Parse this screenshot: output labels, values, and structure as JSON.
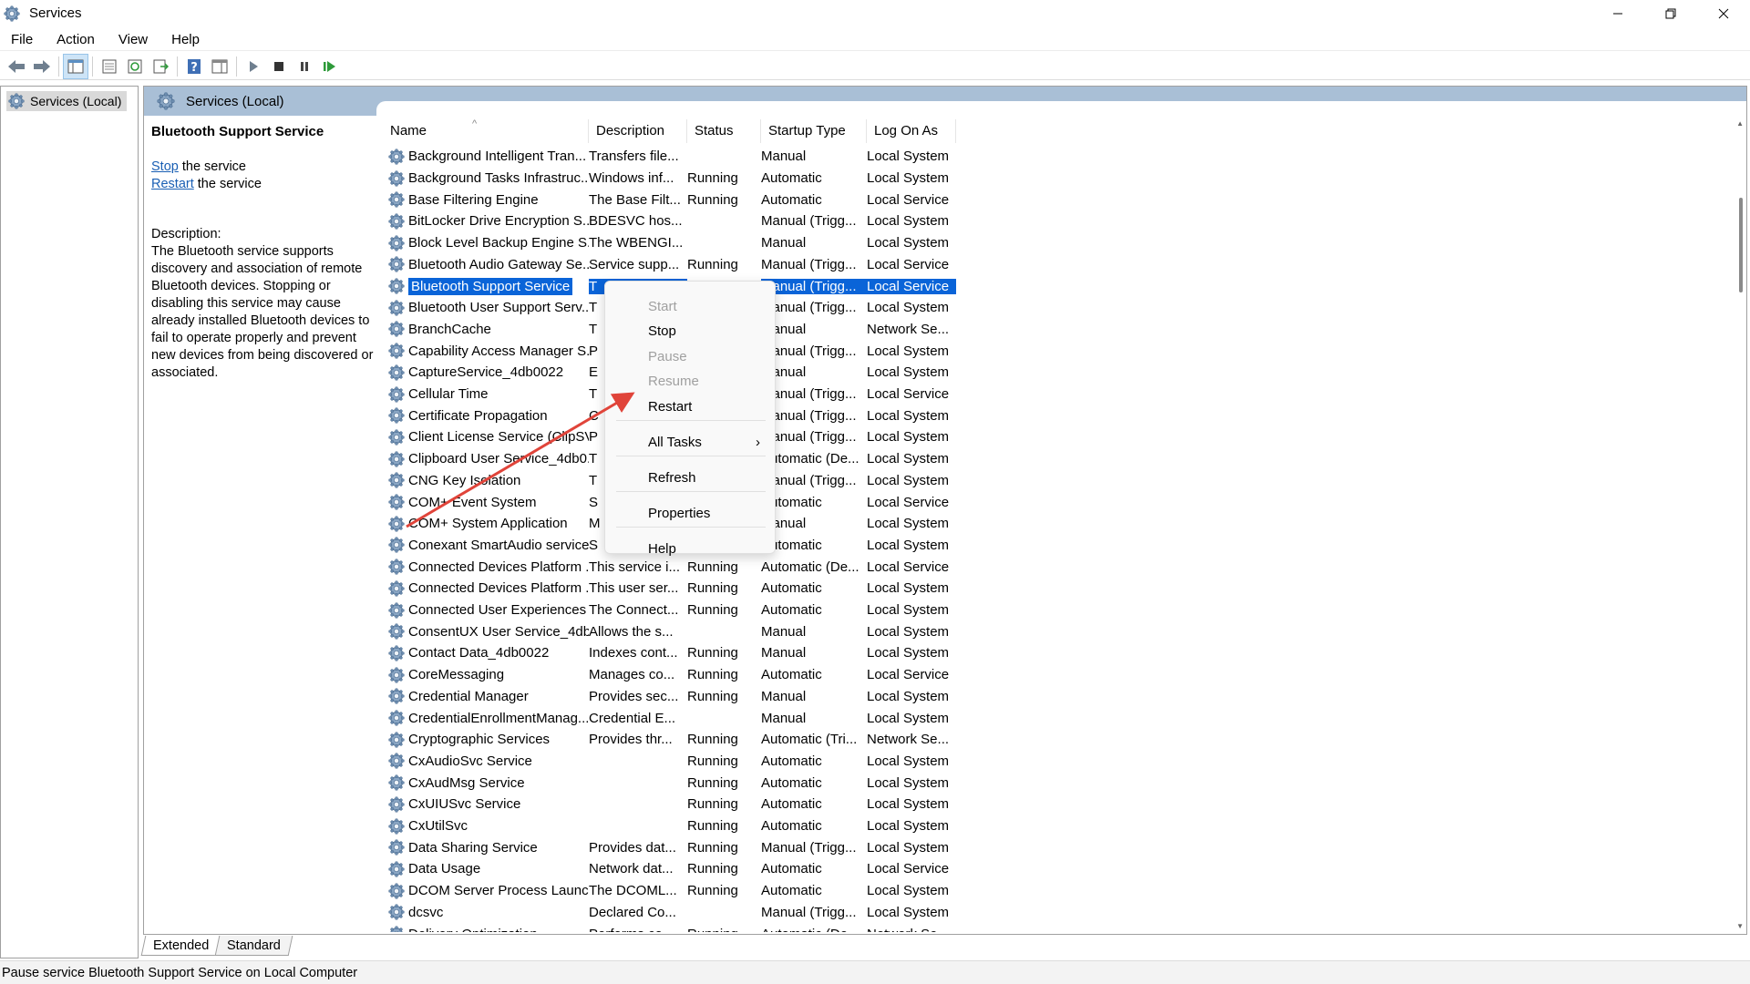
{
  "window": {
    "title": "Services"
  },
  "menubar": {
    "items": [
      "File",
      "Action",
      "View",
      "Help"
    ]
  },
  "toolbar": {
    "buttons": [
      "back-icon",
      "forward-icon",
      "show-hide-console-tree-icon",
      "properties-icon",
      "refresh-icon",
      "export-list-icon",
      "help-icon",
      "show-action-pane-icon",
      "start-service-icon",
      "stop-service-icon",
      "pause-service-icon",
      "restart-service-icon"
    ]
  },
  "tree": {
    "root": "Services (Local)"
  },
  "main": {
    "header_title": "Services (Local)",
    "detail": {
      "service_title": "Bluetooth Support Service",
      "stop_link": "Stop",
      "stop_suffix": " the service",
      "restart_link": "Restart",
      "restart_suffix": " the service",
      "description_label": "Description:",
      "description_text": "The Bluetooth service supports discovery and association of remote Bluetooth devices.  Stopping or disabling this service may cause already installed Bluetooth devices to fail to operate properly and prevent new devices from being discovered or associated."
    },
    "columns": [
      "Name",
      "Description",
      "Status",
      "Startup Type",
      "Log On As"
    ],
    "rows": [
      {
        "name": "Background Intelligent Tran...",
        "desc": "Transfers file...",
        "status": "",
        "startup": "Manual",
        "logon": "Local System"
      },
      {
        "name": "Background Tasks Infrastruc...",
        "desc": "Windows inf...",
        "status": "Running",
        "startup": "Automatic",
        "logon": "Local System"
      },
      {
        "name": "Base Filtering Engine",
        "desc": "The Base Filt...",
        "status": "Running",
        "startup": "Automatic",
        "logon": "Local Service"
      },
      {
        "name": "BitLocker Drive Encryption S...",
        "desc": "BDESVC hos...",
        "status": "",
        "startup": "Manual (Trigg...",
        "logon": "Local System"
      },
      {
        "name": "Block Level Backup Engine S...",
        "desc": "The WBENGI...",
        "status": "",
        "startup": "Manual",
        "logon": "Local System"
      },
      {
        "name": "Bluetooth Audio Gateway Se...",
        "desc": "Service supp...",
        "status": "Running",
        "startup": "Manual (Trigg...",
        "logon": "Local Service"
      },
      {
        "name": "Bluetooth Support Service",
        "desc": "T",
        "status": "",
        "startup": "Manual (Trigg...",
        "logon": "Local Service",
        "selected": true
      },
      {
        "name": "Bluetooth User Support Serv...",
        "desc": "T",
        "status": "",
        "startup": "Manual (Trigg...",
        "logon": "Local System"
      },
      {
        "name": "BranchCache",
        "desc": "T",
        "status": "",
        "startup": "Manual",
        "logon": "Network Se..."
      },
      {
        "name": "Capability Access Manager S...",
        "desc": "P",
        "status": "",
        "startup": "Manual (Trigg...",
        "logon": "Local System"
      },
      {
        "name": "CaptureService_4db0022",
        "desc": "E",
        "status": "",
        "startup": "Manual",
        "logon": "Local System"
      },
      {
        "name": "Cellular Time",
        "desc": "T",
        "status": "",
        "startup": "Manual (Trigg...",
        "logon": "Local Service"
      },
      {
        "name": "Certificate Propagation",
        "desc": "C",
        "status": "",
        "startup": "Manual (Trigg...",
        "logon": "Local System"
      },
      {
        "name": "Client License Service (ClipSV...",
        "desc": "P",
        "status": "",
        "startup": "Manual (Trigg...",
        "logon": "Local System"
      },
      {
        "name": "Clipboard User Service_4db0...",
        "desc": "T",
        "status": "",
        "startup": "Automatic (De...",
        "logon": "Local System"
      },
      {
        "name": "CNG Key Isolation",
        "desc": "T",
        "status": "",
        "startup": "Manual (Trigg...",
        "logon": "Local System"
      },
      {
        "name": "COM+ Event System",
        "desc": "S",
        "status": "",
        "startup": "Automatic",
        "logon": "Local Service"
      },
      {
        "name": "COM+ System Application",
        "desc": "M",
        "status": "",
        "startup": "Manual",
        "logon": "Local System"
      },
      {
        "name": "Conexant SmartAudio service",
        "desc": "S",
        "status": "",
        "startup": "Automatic",
        "logon": "Local System"
      },
      {
        "name": "Connected Devices Platform ...",
        "desc": "This service i...",
        "status": "Running",
        "startup": "Automatic (De...",
        "logon": "Local Service"
      },
      {
        "name": "Connected Devices Platform ...",
        "desc": "This user ser...",
        "status": "Running",
        "startup": "Automatic",
        "logon": "Local System"
      },
      {
        "name": "Connected User Experiences ...",
        "desc": "The Connect...",
        "status": "Running",
        "startup": "Automatic",
        "logon": "Local System"
      },
      {
        "name": "ConsentUX User Service_4db...",
        "desc": "Allows the s...",
        "status": "",
        "startup": "Manual",
        "logon": "Local System"
      },
      {
        "name": "Contact Data_4db0022",
        "desc": "Indexes cont...",
        "status": "Running",
        "startup": "Manual",
        "logon": "Local System"
      },
      {
        "name": "CoreMessaging",
        "desc": "Manages co...",
        "status": "Running",
        "startup": "Automatic",
        "logon": "Local Service"
      },
      {
        "name": "Credential Manager",
        "desc": "Provides sec...",
        "status": "Running",
        "startup": "Manual",
        "logon": "Local System"
      },
      {
        "name": "CredentialEnrollmentManag...",
        "desc": "Credential E...",
        "status": "",
        "startup": "Manual",
        "logon": "Local System"
      },
      {
        "name": "Cryptographic Services",
        "desc": "Provides thr...",
        "status": "Running",
        "startup": "Automatic (Tri...",
        "logon": "Network Se..."
      },
      {
        "name": "CxAudioSvc Service",
        "desc": "",
        "status": "Running",
        "startup": "Automatic",
        "logon": "Local System"
      },
      {
        "name": "CxAudMsg Service",
        "desc": "",
        "status": "Running",
        "startup": "Automatic",
        "logon": "Local System"
      },
      {
        "name": "CxUIUSvc Service",
        "desc": "",
        "status": "Running",
        "startup": "Automatic",
        "logon": "Local System"
      },
      {
        "name": "CxUtilSvc",
        "desc": "",
        "status": "Running",
        "startup": "Automatic",
        "logon": "Local System"
      },
      {
        "name": "Data Sharing Service",
        "desc": "Provides dat...",
        "status": "Running",
        "startup": "Manual (Trigg...",
        "logon": "Local System"
      },
      {
        "name": "Data Usage",
        "desc": "Network dat...",
        "status": "Running",
        "startup": "Automatic",
        "logon": "Local Service"
      },
      {
        "name": "DCOM Server Process Launc...",
        "desc": "The DCOML...",
        "status": "Running",
        "startup": "Automatic",
        "logon": "Local System"
      },
      {
        "name": "dcsvc",
        "desc": "Declared Co...",
        "status": "",
        "startup": "Manual (Trigg...",
        "logon": "Local System"
      },
      {
        "name": "Delivery Optimization",
        "desc": "Performs co...",
        "status": "Running",
        "startup": "Automatic (De...",
        "logon": "Network Se..."
      }
    ]
  },
  "context_menu": {
    "items": [
      {
        "label": "Start",
        "disabled": true
      },
      {
        "label": "Stop",
        "disabled": false
      },
      {
        "label": "Pause",
        "disabled": true
      },
      {
        "label": "Resume",
        "disabled": true
      },
      {
        "label": "Restart",
        "disabled": false
      },
      {
        "label": "All Tasks",
        "disabled": false,
        "submenu": true
      },
      {
        "label": "Refresh",
        "disabled": false
      },
      {
        "label": "Properties",
        "disabled": false
      },
      {
        "label": "Help",
        "disabled": false
      }
    ]
  },
  "tabs": [
    "Extended",
    "Standard"
  ],
  "statusbar": {
    "text": "Pause service Bluetooth Support Service on Local Computer"
  },
  "colors": {
    "selection": "#0a64d8",
    "header_band": "#a9bfd6",
    "link": "#1a5fb4",
    "annotation_arrow": "#e0443a"
  }
}
